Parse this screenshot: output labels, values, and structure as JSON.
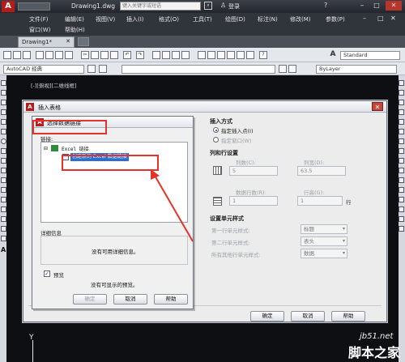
{
  "title_bar": {
    "file_name": "Drawing1.dwg",
    "search_placeholder": "键入关键字或短语",
    "login_label": "登录"
  },
  "menu": {
    "row1": [
      "文件(F)",
      "编辑(E)",
      "视图(V)",
      "插入(I)",
      "格式(O)",
      "工具(T)",
      "绘图(D)",
      "标注(N)",
      "修改(M)",
      "参数(P)"
    ],
    "row2": [
      "窗口(W)",
      "帮助(H)"
    ]
  },
  "doc_tab": {
    "label": "Drawing1*"
  },
  "workspace": {
    "name": "AutoCAD 经典",
    "text_style": "Standard",
    "layer": "ByLayer"
  },
  "viewport_label": "[-][俯视][二维线框]",
  "insert_table_dialog": {
    "title": "插入表格",
    "insert_method": {
      "heading": "插入方式",
      "point_option": "指定插入点(I)",
      "window_option": "指定窗口(W)"
    },
    "rows_cols": {
      "heading": "列和行设置",
      "columns_label": "列数(C):",
      "columns_value": "5",
      "col_width_label": "列宽(D):",
      "col_width_value": "63.5",
      "data_rows_label": "数据行数(R):",
      "data_rows_value": "1",
      "row_height_label": "行高(G):",
      "row_height_value": "1",
      "row_unit": "行"
    },
    "cell_styles": {
      "heading": "设置单元样式",
      "first_row_label": "第一行单元样式:",
      "first_row_value": "标题",
      "second_row_label": "第二行单元样式:",
      "second_row_value": "表头",
      "other_rows_label": "所有其他行单元样式:",
      "other_rows_value": "数据"
    },
    "buttons": {
      "ok": "确定",
      "cancel": "取消",
      "help": "帮助"
    }
  },
  "select_data_link_dialog": {
    "title": "选择数据链接",
    "links_label": "链接:",
    "tree_root": "Excel 链接",
    "tree_child": "创建新的 Excel 数据链接",
    "details_heading": "详细信息",
    "details_empty": "没有可用详细信息。",
    "preview_label": "预览",
    "preview_checked": true,
    "preview_empty": "没有可显示的预览。",
    "buttons": {
      "ok": "确定",
      "cancel": "取消",
      "help": "帮助"
    }
  },
  "watermark": {
    "line1": "jb51.net",
    "line2": "脚本之家"
  },
  "colors": {
    "accent_red": "#e2342a",
    "selection_blue": "#1b4fb8",
    "canvas": "#0d0f12"
  }
}
